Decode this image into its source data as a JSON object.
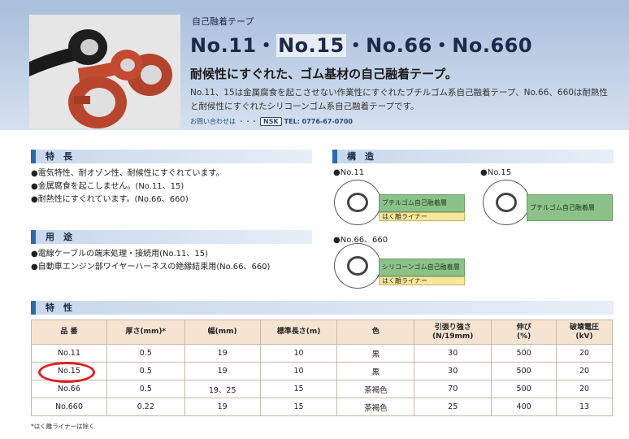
{
  "header": {
    "subtitle": "自己融着テープ",
    "title_a": "No.11・",
    "title_b": "No.15",
    "title_c": "・No.66・No.660",
    "tagline": "耐候性にすぐれた、ゴム基材の自己融着テープ。",
    "desc_line1": "No.11、15は金属腐食を起こさせない作業性にすぐれたブチルゴム系自己融着テープ、No.66、660は耐熱性",
    "desc_line2": "と耐候性にすぐれたシリコーンゴム系自己融着テープです。",
    "contact_label": "お問い合わせは",
    "contact_dots": "・・・",
    "contact_badge": "NSK",
    "contact_tel": "TEL: 0776-67-0700"
  },
  "features": {
    "heading": "特　長",
    "items": [
      "●電気特性、耐オゾン性、耐候性にすぐれています。",
      "●金属腐食を起こしません。(No.11、15)",
      "●耐熱性にすぐれています。(No.66、660)"
    ]
  },
  "uses": {
    "heading": "用　途",
    "items": [
      "●電線ケーブルの端末処理・接続用(No.11、15)",
      "●自動車エンジン部ワイヤーハーネスの絶縁結束用(No.66、660)"
    ]
  },
  "structure": {
    "heading": "構　造",
    "no11": {
      "caption": "●No.11",
      "layer1": "ブチルゴム自己融着層",
      "layer2": "はく離ライナー"
    },
    "no15": {
      "caption": "●No.15",
      "layer1": "ブチルゴム自己融着層"
    },
    "no66": {
      "caption": "●No.66、660",
      "layer1": "シリコーンゴム自己融着層",
      "layer2": "はく離ライナー"
    }
  },
  "properties": {
    "heading": "特　性",
    "columns": [
      "品 番",
      "厚さ(mm)*",
      "幅(mm)",
      "標準長さ(m)",
      "色",
      "引張り強さ\n(N/19mm)",
      "伸び\n(%)",
      "破壊電圧\n(kV)"
    ],
    "rows": [
      [
        "No.11",
        "0.5",
        "19",
        "10",
        "黒",
        "30",
        "500",
        "20"
      ],
      [
        "No.15",
        "0.5",
        "19",
        "10",
        "黒",
        "30",
        "500",
        "20"
      ],
      [
        "No.66",
        "0.5",
        "19、25",
        "15",
        "茶褐色",
        "70",
        "500",
        "20"
      ],
      [
        "No.660",
        "0.22",
        "19",
        "15",
        "茶褐色",
        "25",
        "400",
        "13"
      ]
    ],
    "note": "*はく離ライナーは除く"
  },
  "colors": {
    "accent": "#2a6ab0",
    "highlight_circle": "#e02020",
    "table_header": "#f6e4d3"
  }
}
